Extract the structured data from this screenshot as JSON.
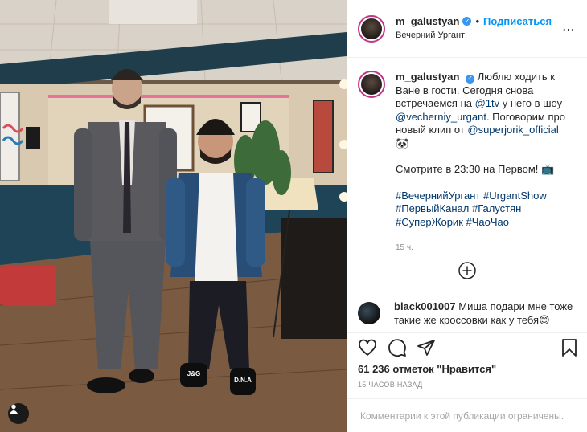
{
  "photo": {
    "sign_left": "J&G",
    "sign_right": "D.N.A"
  },
  "header": {
    "username": "m_galustyan",
    "separator": "•",
    "follow_label": "Подписаться",
    "location": "Вечерний Ургант",
    "more_icon": "⋯"
  },
  "caption": {
    "username": "m_galustyan",
    "text_part1": "Люблю ходить к Ване в гости. Сегодня снова встречаемся на ",
    "mention_1tv": "@1tv",
    "text_part2": " у него в шоу ",
    "mention_urgant": "@vecherniy_urgant",
    "text_part3": ". Поговорим про новый клип от ",
    "mention_jorik": "@superjorik_official",
    "emoji_1": "🐼",
    "line2": "Смотрите в 23:30 на Первом! ",
    "emoji_2": "📺",
    "hashtag_1": "#ВечернийУргант",
    "hashtag_2": "#UrgantShow",
    "hashtag_3": "#ПервыйКанал",
    "hashtag_4": "#Галустян",
    "hashtag_5": "#СуперЖорик",
    "hashtag_6": "#ЧаоЧао",
    "time": "15 ч."
  },
  "comment": {
    "username": "black001007",
    "text": "Миша подари мне тоже такие же кроссовки как у тебя",
    "emoji": "😊"
  },
  "stats": {
    "likes_count": "61 236",
    "likes_suffix": "отметок \"Нравится\"",
    "ago": "15 ЧАСОВ НАЗАД"
  },
  "footer": {
    "comments_disabled": "Комментарии к этой публикации ограничены."
  },
  "colors": {
    "accent": "#0095f6",
    "link": "#00376b",
    "muted": "#8e8e8e",
    "border": "#efefef",
    "verified": "#3897f0"
  }
}
